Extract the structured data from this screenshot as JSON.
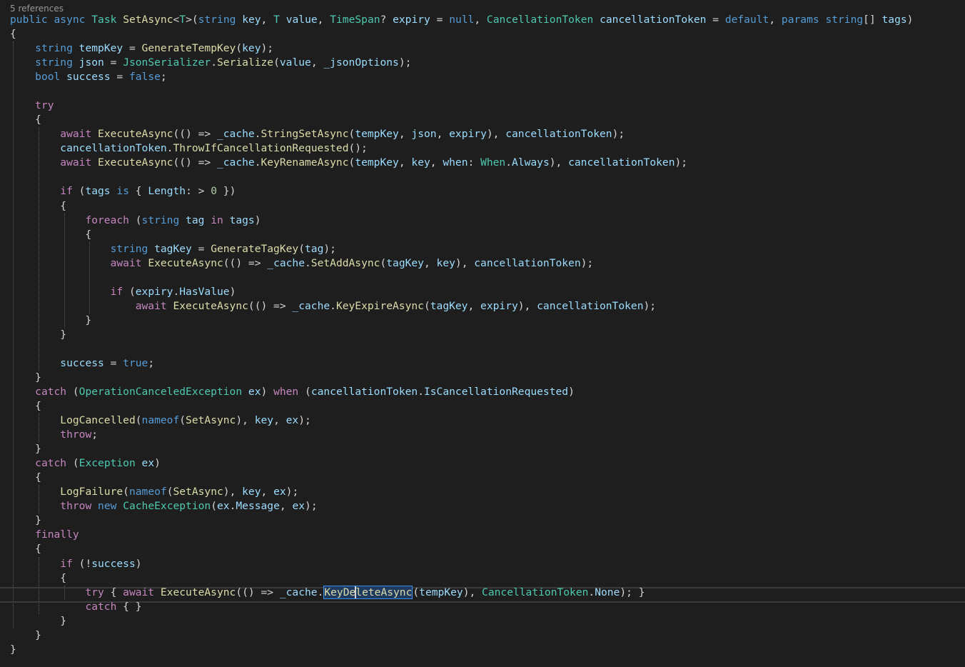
{
  "editor": {
    "codelens": "5 references",
    "lines": [
      [
        [
          "kw",
          "public"
        ],
        [
          "plain",
          " "
        ],
        [
          "kw",
          "async"
        ],
        [
          "plain",
          " "
        ],
        [
          "type",
          "Task"
        ],
        [
          "plain",
          " "
        ],
        [
          "fn",
          "SetAsync"
        ],
        [
          "plain",
          "<"
        ],
        [
          "type",
          "T"
        ],
        [
          "plain",
          ">("
        ],
        [
          "kw",
          "string"
        ],
        [
          "plain",
          " "
        ],
        [
          "var",
          "key"
        ],
        [
          "plain",
          ", "
        ],
        [
          "type",
          "T"
        ],
        [
          "plain",
          " "
        ],
        [
          "var",
          "value"
        ],
        [
          "plain",
          ", "
        ],
        [
          "type",
          "TimeSpan"
        ],
        [
          "plain",
          "? "
        ],
        [
          "var",
          "expiry"
        ],
        [
          "plain",
          " = "
        ],
        [
          "kw",
          "null"
        ],
        [
          "plain",
          ", "
        ],
        [
          "type",
          "CancellationToken"
        ],
        [
          "plain",
          " "
        ],
        [
          "var",
          "cancellationToken"
        ],
        [
          "plain",
          " = "
        ],
        [
          "kw",
          "default"
        ],
        [
          "plain",
          ", "
        ],
        [
          "kw",
          "params"
        ],
        [
          "plain",
          " "
        ],
        [
          "kw",
          "string"
        ],
        [
          "plain",
          "[] "
        ],
        [
          "var",
          "tags"
        ],
        [
          "plain",
          ")"
        ]
      ],
      [
        [
          "plain",
          "{"
        ]
      ],
      [
        [
          "plain",
          "    "
        ],
        [
          "kw",
          "string"
        ],
        [
          "plain",
          " "
        ],
        [
          "var",
          "tempKey"
        ],
        [
          "plain",
          " = "
        ],
        [
          "fn",
          "GenerateTempKey"
        ],
        [
          "plain",
          "("
        ],
        [
          "var",
          "key"
        ],
        [
          "plain",
          ");"
        ]
      ],
      [
        [
          "plain",
          "    "
        ],
        [
          "kw",
          "string"
        ],
        [
          "plain",
          " "
        ],
        [
          "var",
          "json"
        ],
        [
          "plain",
          " = "
        ],
        [
          "type",
          "JsonSerializer"
        ],
        [
          "plain",
          "."
        ],
        [
          "fn",
          "Serialize"
        ],
        [
          "plain",
          "("
        ],
        [
          "var",
          "value"
        ],
        [
          "plain",
          ", "
        ],
        [
          "var",
          "_jsonOptions"
        ],
        [
          "plain",
          ");"
        ]
      ],
      [
        [
          "plain",
          "    "
        ],
        [
          "kw",
          "bool"
        ],
        [
          "plain",
          " "
        ],
        [
          "var",
          "success"
        ],
        [
          "plain",
          " = "
        ],
        [
          "kw",
          "false"
        ],
        [
          "plain",
          ";"
        ]
      ],
      [],
      [
        [
          "plain",
          "    "
        ],
        [
          "ctl",
          "try"
        ]
      ],
      [
        [
          "plain",
          "    {"
        ]
      ],
      [
        [
          "plain",
          "        "
        ],
        [
          "ctl",
          "await"
        ],
        [
          "plain",
          " "
        ],
        [
          "fn",
          "ExecuteAsync"
        ],
        [
          "plain",
          "(() => "
        ],
        [
          "var",
          "_cache"
        ],
        [
          "plain",
          "."
        ],
        [
          "fn",
          "StringSetAsync"
        ],
        [
          "plain",
          "("
        ],
        [
          "var",
          "tempKey"
        ],
        [
          "plain",
          ", "
        ],
        [
          "var",
          "json"
        ],
        [
          "plain",
          ", "
        ],
        [
          "var",
          "expiry"
        ],
        [
          "plain",
          "), "
        ],
        [
          "var",
          "cancellationToken"
        ],
        [
          "plain",
          ");"
        ]
      ],
      [
        [
          "plain",
          "        "
        ],
        [
          "var",
          "cancellationToken"
        ],
        [
          "plain",
          "."
        ],
        [
          "fn",
          "ThrowIfCancellationRequested"
        ],
        [
          "plain",
          "();"
        ]
      ],
      [
        [
          "plain",
          "        "
        ],
        [
          "ctl",
          "await"
        ],
        [
          "plain",
          " "
        ],
        [
          "fn",
          "ExecuteAsync"
        ],
        [
          "plain",
          "(() => "
        ],
        [
          "var",
          "_cache"
        ],
        [
          "plain",
          "."
        ],
        [
          "fn",
          "KeyRenameAsync"
        ],
        [
          "plain",
          "("
        ],
        [
          "var",
          "tempKey"
        ],
        [
          "plain",
          ", "
        ],
        [
          "var",
          "key"
        ],
        [
          "plain",
          ", "
        ],
        [
          "var",
          "when"
        ],
        [
          "plain",
          ": "
        ],
        [
          "type",
          "When"
        ],
        [
          "plain",
          "."
        ],
        [
          "var",
          "Always"
        ],
        [
          "plain",
          "), "
        ],
        [
          "var",
          "cancellationToken"
        ],
        [
          "plain",
          ");"
        ]
      ],
      [],
      [
        [
          "plain",
          "        "
        ],
        [
          "ctl",
          "if"
        ],
        [
          "plain",
          " ("
        ],
        [
          "var",
          "tags"
        ],
        [
          "plain",
          " "
        ],
        [
          "kw",
          "is"
        ],
        [
          "plain",
          " { "
        ],
        [
          "var",
          "Length"
        ],
        [
          "plain",
          ": > "
        ],
        [
          "num",
          "0"
        ],
        [
          "plain",
          " })"
        ]
      ],
      [
        [
          "plain",
          "        {"
        ]
      ],
      [
        [
          "plain",
          "            "
        ],
        [
          "ctl",
          "foreach"
        ],
        [
          "plain",
          " ("
        ],
        [
          "kw",
          "string"
        ],
        [
          "plain",
          " "
        ],
        [
          "var",
          "tag"
        ],
        [
          "plain",
          " "
        ],
        [
          "ctl",
          "in"
        ],
        [
          "plain",
          " "
        ],
        [
          "var",
          "tags"
        ],
        [
          "plain",
          ")"
        ]
      ],
      [
        [
          "plain",
          "            {"
        ]
      ],
      [
        [
          "plain",
          "                "
        ],
        [
          "kw",
          "string"
        ],
        [
          "plain",
          " "
        ],
        [
          "var",
          "tagKey"
        ],
        [
          "plain",
          " = "
        ],
        [
          "fn",
          "GenerateTagKey"
        ],
        [
          "plain",
          "("
        ],
        [
          "var",
          "tag"
        ],
        [
          "plain",
          ");"
        ]
      ],
      [
        [
          "plain",
          "                "
        ],
        [
          "ctl",
          "await"
        ],
        [
          "plain",
          " "
        ],
        [
          "fn",
          "ExecuteAsync"
        ],
        [
          "plain",
          "(() => "
        ],
        [
          "var",
          "_cache"
        ],
        [
          "plain",
          "."
        ],
        [
          "fn",
          "SetAddAsync"
        ],
        [
          "plain",
          "("
        ],
        [
          "var",
          "tagKey"
        ],
        [
          "plain",
          ", "
        ],
        [
          "var",
          "key"
        ],
        [
          "plain",
          "), "
        ],
        [
          "var",
          "cancellationToken"
        ],
        [
          "plain",
          ");"
        ]
      ],
      [],
      [
        [
          "plain",
          "                "
        ],
        [
          "ctl",
          "if"
        ],
        [
          "plain",
          " ("
        ],
        [
          "var",
          "expiry"
        ],
        [
          "plain",
          "."
        ],
        [
          "var",
          "HasValue"
        ],
        [
          "plain",
          ")"
        ]
      ],
      [
        [
          "plain",
          "                    "
        ],
        [
          "ctl",
          "await"
        ],
        [
          "plain",
          " "
        ],
        [
          "fn",
          "ExecuteAsync"
        ],
        [
          "plain",
          "(() => "
        ],
        [
          "var",
          "_cache"
        ],
        [
          "plain",
          "."
        ],
        [
          "fn",
          "KeyExpireAsync"
        ],
        [
          "plain",
          "("
        ],
        [
          "var",
          "tagKey"
        ],
        [
          "plain",
          ", "
        ],
        [
          "var",
          "expiry"
        ],
        [
          "plain",
          "), "
        ],
        [
          "var",
          "cancellationToken"
        ],
        [
          "plain",
          ");"
        ]
      ],
      [
        [
          "plain",
          "            }"
        ]
      ],
      [
        [
          "plain",
          "        }"
        ]
      ],
      [],
      [
        [
          "plain",
          "        "
        ],
        [
          "var",
          "success"
        ],
        [
          "plain",
          " = "
        ],
        [
          "kw",
          "true"
        ],
        [
          "plain",
          ";"
        ]
      ],
      [
        [
          "plain",
          "    }"
        ]
      ],
      [
        [
          "plain",
          "    "
        ],
        [
          "ctl",
          "catch"
        ],
        [
          "plain",
          " ("
        ],
        [
          "type",
          "OperationCanceledException"
        ],
        [
          "plain",
          " "
        ],
        [
          "var",
          "ex"
        ],
        [
          "plain",
          ") "
        ],
        [
          "ctl",
          "when"
        ],
        [
          "plain",
          " ("
        ],
        [
          "var",
          "cancellationToken"
        ],
        [
          "plain",
          "."
        ],
        [
          "var",
          "IsCancellationRequested"
        ],
        [
          "plain",
          ")"
        ]
      ],
      [
        [
          "plain",
          "    {"
        ]
      ],
      [
        [
          "plain",
          "        "
        ],
        [
          "fn",
          "LogCancelled"
        ],
        [
          "plain",
          "("
        ],
        [
          "kw",
          "nameof"
        ],
        [
          "plain",
          "("
        ],
        [
          "fn",
          "SetAsync"
        ],
        [
          "plain",
          "), "
        ],
        [
          "var",
          "key"
        ],
        [
          "plain",
          ", "
        ],
        [
          "var",
          "ex"
        ],
        [
          "plain",
          ");"
        ]
      ],
      [
        [
          "plain",
          "        "
        ],
        [
          "ctl",
          "throw"
        ],
        [
          "plain",
          ";"
        ]
      ],
      [
        [
          "plain",
          "    }"
        ]
      ],
      [
        [
          "plain",
          "    "
        ],
        [
          "ctl",
          "catch"
        ],
        [
          "plain",
          " ("
        ],
        [
          "type",
          "Exception"
        ],
        [
          "plain",
          " "
        ],
        [
          "var",
          "ex"
        ],
        [
          "plain",
          ")"
        ]
      ],
      [
        [
          "plain",
          "    {"
        ]
      ],
      [
        [
          "plain",
          "        "
        ],
        [
          "fn",
          "LogFailure"
        ],
        [
          "plain",
          "("
        ],
        [
          "kw",
          "nameof"
        ],
        [
          "plain",
          "("
        ],
        [
          "fn",
          "SetAsync"
        ],
        [
          "plain",
          "), "
        ],
        [
          "var",
          "key"
        ],
        [
          "plain",
          ", "
        ],
        [
          "var",
          "ex"
        ],
        [
          "plain",
          ");"
        ]
      ],
      [
        [
          "plain",
          "        "
        ],
        [
          "ctl",
          "throw"
        ],
        [
          "plain",
          " "
        ],
        [
          "kw",
          "new"
        ],
        [
          "plain",
          " "
        ],
        [
          "type",
          "CacheException"
        ],
        [
          "plain",
          "("
        ],
        [
          "var",
          "ex"
        ],
        [
          "plain",
          "."
        ],
        [
          "var",
          "Message"
        ],
        [
          "plain",
          ", "
        ],
        [
          "var",
          "ex"
        ],
        [
          "plain",
          ");"
        ]
      ],
      [
        [
          "plain",
          "    }"
        ]
      ],
      [
        [
          "plain",
          "    "
        ],
        [
          "ctl",
          "finally"
        ]
      ],
      [
        [
          "plain",
          "    {"
        ]
      ],
      [
        [
          "plain",
          "        "
        ],
        [
          "ctl",
          "if"
        ],
        [
          "plain",
          " (!"
        ],
        [
          "var",
          "success"
        ],
        [
          "plain",
          ")"
        ]
      ],
      [
        [
          "plain",
          "        {"
        ]
      ],
      [
        [
          "plain",
          "            "
        ],
        [
          "ctl",
          "try"
        ],
        [
          "plain",
          " { "
        ],
        [
          "ctl",
          "await"
        ],
        [
          "plain",
          " "
        ],
        [
          "fn",
          "ExecuteAsync"
        ],
        [
          "plain",
          "(() => "
        ],
        [
          "var",
          "_cache"
        ],
        [
          "plain",
          "."
        ],
        [
          "fn",
          "KeyDeleteAsync"
        ],
        [
          "plain",
          "("
        ],
        [
          "var",
          "tempKey"
        ],
        [
          "plain",
          "), "
        ],
        [
          "type",
          "CancellationToken"
        ],
        [
          "plain",
          "."
        ],
        [
          "var",
          "None"
        ],
        [
          "plain",
          "); }"
        ]
      ],
      [
        [
          "plain",
          "            "
        ],
        [
          "ctl",
          "catch"
        ],
        [
          "plain",
          " { }"
        ]
      ],
      [
        [
          "plain",
          "        }"
        ]
      ],
      [
        [
          "plain",
          "    }"
        ]
      ],
      [
        [
          "plain",
          "}"
        ]
      ]
    ]
  }
}
